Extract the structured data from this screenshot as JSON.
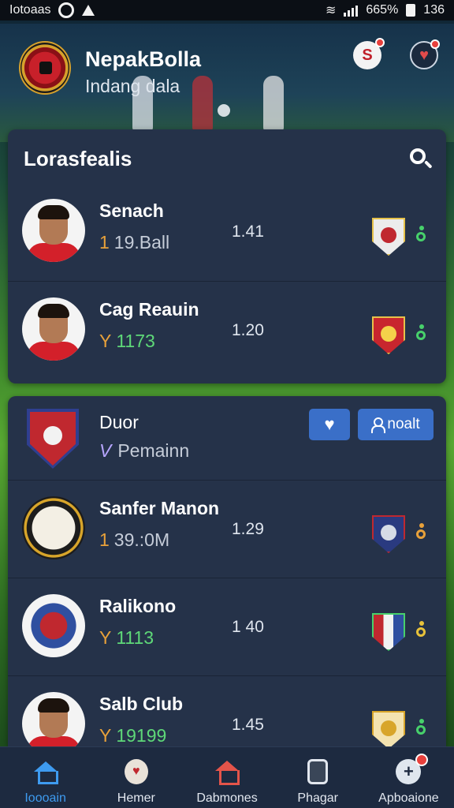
{
  "status_bar": {
    "left_text": "Iotoaas",
    "battery_percent": "665%",
    "time": "136"
  },
  "header": {
    "title": "NepakBolla",
    "subtitle": "Indang dala",
    "icons": [
      "club-crest-icon",
      "s-logo-icon",
      "shield-heart-icon"
    ]
  },
  "card1": {
    "title": "Lorasfealis",
    "rows": [
      {
        "name": "Senach",
        "sub_glyph": "1",
        "sub": "19.Ball",
        "rating": "1.41",
        "sub_color": "#c5ccd8",
        "glyph_color": "#e8a13a",
        "fav_color": "#47d16b"
      },
      {
        "name": "Cag Reauin",
        "sub_glyph": "Y",
        "sub": "1173",
        "rating": "1.20",
        "sub_color": "#5ed878",
        "glyph_color": "#e8a13a",
        "fav_color": "#47d16b"
      }
    ]
  },
  "card2": {
    "club": {
      "name": "Duor",
      "sub_glyph": "V",
      "sub": "Pemainn",
      "follow_label": "noalt"
    },
    "rows": [
      {
        "name": "Sanfer Manon",
        "sub_glyph": "1",
        "sub": "39.:0M",
        "rating": "1.29",
        "sub_color": "#c5ccd8",
        "glyph_color": "#e8a13a",
        "fav_color": "#e8a13a"
      },
      {
        "name": "Ralikono",
        "sub_glyph": "Y",
        "sub": "1113",
        "rating": "1 40",
        "sub_color": "#5ed878",
        "glyph_color": "#e8a13a",
        "fav_color": "#e8c23a"
      },
      {
        "name": "Salb Club",
        "sub_glyph": "Y",
        "sub": "19199",
        "rating": "1.45",
        "sub_color": "#5ed878",
        "glyph_color": "#e8a13a",
        "fav_color": "#47d16b"
      }
    ]
  },
  "bottom_nav": [
    {
      "label": "Ioooain",
      "icon": "home-icon",
      "active": true
    },
    {
      "label": "Hemer",
      "icon": "shield-icon",
      "active": false
    },
    {
      "label": "Dabmones",
      "icon": "house-icon",
      "active": false
    },
    {
      "label": "Phagar",
      "icon": "phone-icon",
      "active": false
    },
    {
      "label": "Apboaione",
      "icon": "settings-icon",
      "active": false
    }
  ],
  "colors": {
    "accent": "#3e9bf0",
    "button": "#3a6fc8",
    "card": "#253249",
    "notification": "#e8403c"
  }
}
